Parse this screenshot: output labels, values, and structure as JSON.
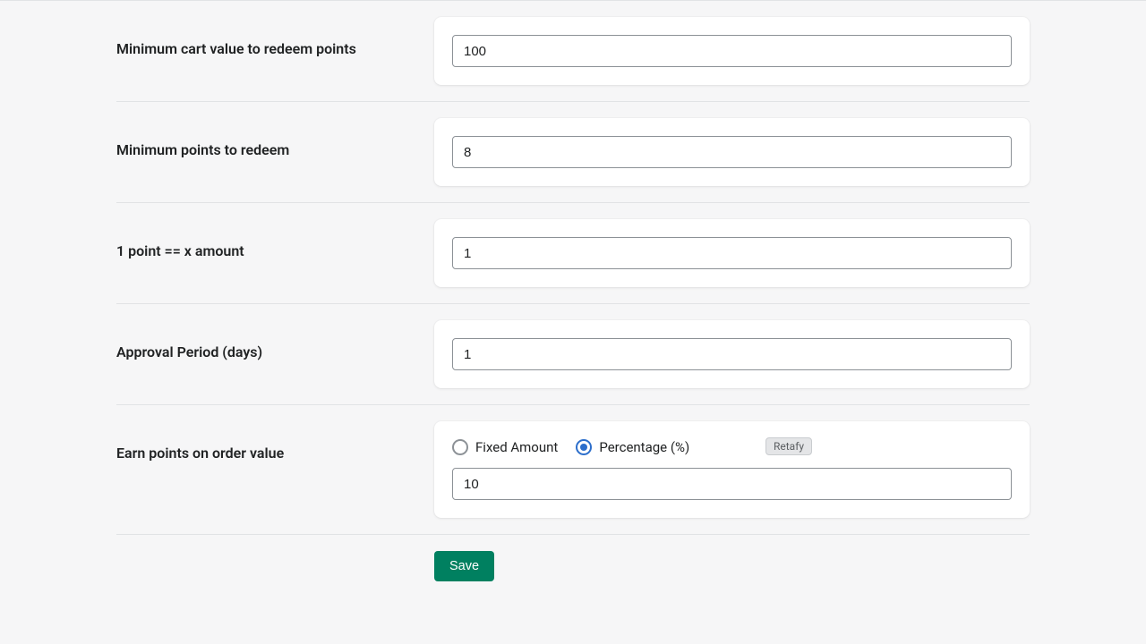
{
  "rows": {
    "min_cart": {
      "label": "Minimum cart value to redeem points",
      "value": "100"
    },
    "min_points": {
      "label": "Minimum points to redeem",
      "value": "8"
    },
    "point_amount": {
      "label": "1 point == x amount",
      "value": "1"
    },
    "approval": {
      "label": "Approval Period (days)",
      "value": "1"
    },
    "earn": {
      "label": "Earn points on order value",
      "options": {
        "fixed": "Fixed Amount",
        "percentage": "Percentage (%)"
      },
      "selected": "percentage",
      "value": "10",
      "badge": "Retafy"
    }
  },
  "buttons": {
    "save": "Save"
  }
}
